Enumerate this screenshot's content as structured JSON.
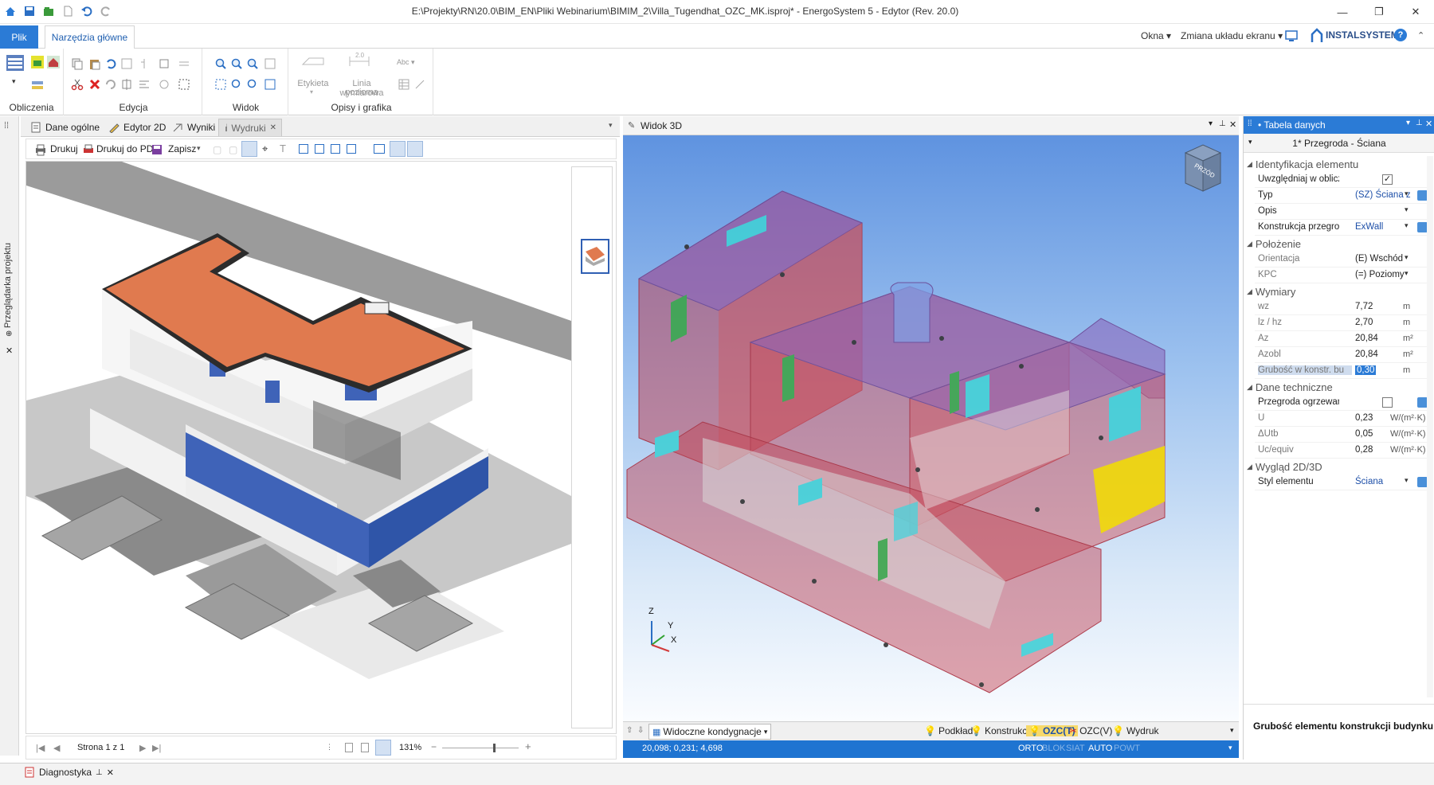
{
  "window": {
    "title": "E:\\Projekty\\RN\\20.0\\BIM_EN\\Pliki Webinarium\\BIMIM_2\\Villa_Tugendhat_OZC_MK.isproj* - EnergoSystem 5 - Edytor (Rev. 20.0)",
    "controls": [
      "—",
      "❐",
      "✕"
    ]
  },
  "ribbon": {
    "tabs": [
      "Plik",
      "Narzędzia główne"
    ],
    "right": {
      "okna": "Okna ▾",
      "zmiana": "Zmiana układu ekranu ▾",
      "brand": "INSTALSYSTEM"
    },
    "groups": [
      "Obliczenia",
      "Edycja",
      "Widok",
      "Opisy i grafika"
    ],
    "etykieta": "Etykieta",
    "linia": [
      "Linia wymiarowa",
      "pozioma"
    ],
    "dim_value": "2.0",
    "abc": "Abc ▾"
  },
  "left_panel": {
    "title": "Przeglądarka projektu",
    "pin": "⊕",
    "close": "✕"
  },
  "document": {
    "tabs": [
      "Dane ogólne",
      "Edytor 2D",
      "Wyniki",
      "Wydruki"
    ],
    "active_tab": "Wydruki",
    "toolbar": {
      "drukuj": "Drukuj",
      "drukuj_pdf": "Drukuj do PDF",
      "zapisz": "Zapisz"
    },
    "page_label": "Strona 1 z 1",
    "zoom": "131%"
  },
  "view3d": {
    "title": "Widok 3D",
    "cube_label": "PRZÓD",
    "axes": {
      "z": "Z",
      "y": "Y",
      "x": "X"
    },
    "status": {
      "kondygnacje": "Widoczne kondygnacje",
      "layers": [
        "Podkład",
        "Konstrukcja",
        "OZC(T)",
        "OZC(V)",
        "Wydruk"
      ]
    },
    "coords": "20,098; 0,231; 4,698",
    "modes": [
      {
        "label": "ORTO",
        "on": true
      },
      {
        "label": "BLOK",
        "on": false
      },
      {
        "label": "SIAT",
        "on": false
      },
      {
        "label": "AUTO",
        "on": true
      },
      {
        "label": "POWT",
        "on": false
      }
    ]
  },
  "data_panel": {
    "title": "• Tabela danych",
    "subtitle": "1* Przegroda - Ściana",
    "sections": {
      "s1": "Identyfikacja elementu",
      "s2": "Położenie",
      "s3": "Wymiary",
      "s4": "Dane techniczne",
      "s5": "Wygląd 2D/3D"
    },
    "rows": {
      "uwzgl": {
        "label": "Uwzględniaj w oblicz",
        "check": "✓"
      },
      "typ": {
        "label": "Typ",
        "value": "(SZ) Ściana z"
      },
      "opis": {
        "label": "Opis",
        "value": ""
      },
      "konstr": {
        "label": "Konstrukcja przegroc",
        "value": "ExWall"
      },
      "orient": {
        "label": "Orientacja",
        "value": "(E) Wschód"
      },
      "kpc": {
        "label": "KPC",
        "value": "(=) Poziomy"
      },
      "wz": {
        "label": "wz",
        "value": "7,72",
        "unit": "m"
      },
      "lz": {
        "label": "lz / hz",
        "value": "2,70",
        "unit": "m"
      },
      "az": {
        "label": "Az",
        "value": "20,84",
        "unit": "m²"
      },
      "azobl": {
        "label": "Azobl",
        "value": "20,84",
        "unit": "m²"
      },
      "grub": {
        "label": "Grubość w konstr. bu",
        "value": "0,30",
        "unit": "m"
      },
      "ogrz": {
        "label": "Przegroda ogrzewana",
        "check": ""
      },
      "u": {
        "label": "U",
        "value": "0,23",
        "unit": "W/(m²·K)"
      },
      "dutb": {
        "label": "ΔUtb",
        "value": "0,05",
        "unit": "W/(m²·K)"
      },
      "uc": {
        "label": "Uc/equiv",
        "value": "0,28",
        "unit": "W/(m²·K)"
      },
      "styl": {
        "label": "Styl elementu",
        "value": "Ściana"
      }
    },
    "description": "Grubość elementu konstrukcji budynku"
  },
  "bottom": {
    "diag": "Diagnostyka"
  },
  "colors": {
    "accent": "#2b7bd6",
    "roof": "#e07a4f",
    "wall_red": "#d1545b",
    "wall_purple": "#8a5fb8",
    "window_cyan": "#42cfd6",
    "yellow": "#f2d300"
  }
}
